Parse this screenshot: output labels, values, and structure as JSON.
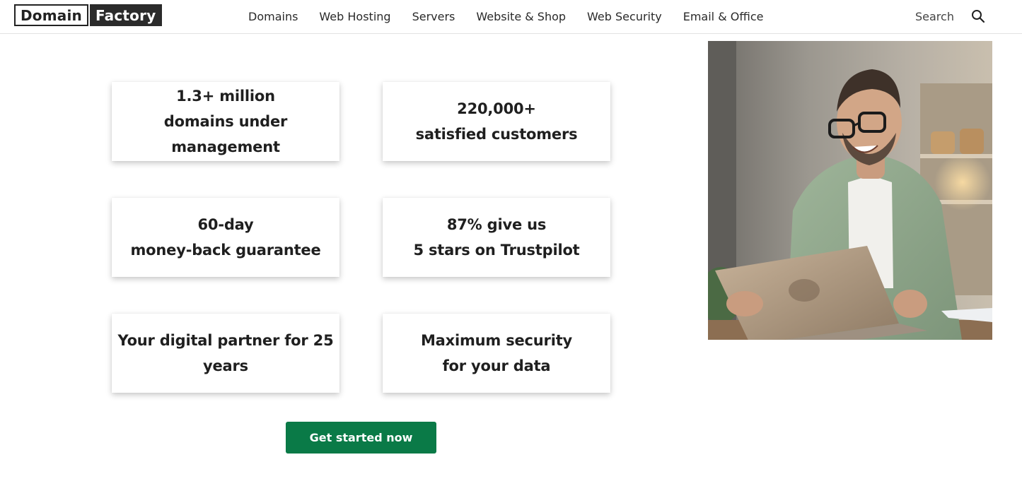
{
  "header": {
    "logo": {
      "part_a": "Domain",
      "part_b": "Factory"
    },
    "nav": [
      {
        "label": "Domains"
      },
      {
        "label": "Web Hosting"
      },
      {
        "label": "Servers"
      },
      {
        "label": "Website & Shop"
      },
      {
        "label": "Web Security"
      },
      {
        "label": "Email & Office"
      }
    ],
    "search": {
      "label": "Search",
      "icon": "search-icon"
    }
  },
  "stats": [
    {
      "line1": "1.3+ million",
      "line2": "domains under management"
    },
    {
      "line1": "220,000+",
      "line2": "satisfied customers"
    },
    {
      "line1": "60-day",
      "line2": "money-back guarantee"
    },
    {
      "line1": "87% give us",
      "line2": "5 stars on Trustpilot"
    },
    {
      "line1": "Your digital partner for 25",
      "line2": "years"
    },
    {
      "line1": "Maximum security",
      "line2": "for your data"
    }
  ],
  "cta": {
    "label": "Get started now"
  },
  "colors": {
    "accent": "#0a7a47",
    "logo_dark": "#2b2b2b",
    "text": "#1f1f1f"
  }
}
